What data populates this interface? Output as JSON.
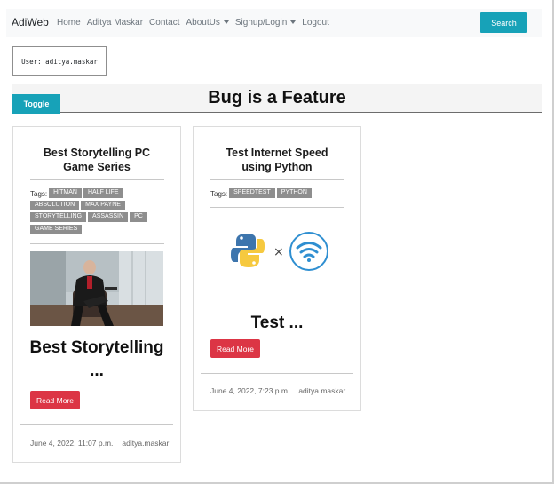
{
  "navbar": {
    "brand": "AdiWeb",
    "links": [
      "Home",
      "Aditya Maskar",
      "Contact"
    ],
    "dropdowns": [
      "AboutUs",
      "Signup/Login"
    ],
    "logout": "Logout",
    "search_label": "Search"
  },
  "user": {
    "label": "User: aditya.maskar"
  },
  "header": {
    "toggle_label": "Toggle",
    "title": "Bug is a Feature"
  },
  "cards": [
    {
      "title": "Best Storytelling PC Game Series",
      "tags_label": "Tags:",
      "tags": [
        "HITMAN",
        "HALF LIFE",
        "ABSOLUTION",
        "MAX PAYNE",
        "STORYTELLING",
        "ASSASSIN",
        "PC",
        "GAME SERIES"
      ],
      "excerpt": "Best Storytelling ...",
      "read_more": "Read More",
      "date": "June 4, 2022, 11:07 p.m.",
      "author": "aditya.maskar"
    },
    {
      "title": "Test Internet Speed using Python",
      "tags_label": "Tags:",
      "tags": [
        "SPEEDTEST",
        "PYTHON"
      ],
      "excerpt": "Test ...",
      "read_more": "Read More",
      "date": "June 4, 2022, 7:23 p.m.",
      "author": "aditya.maskar"
    }
  ],
  "colors": {
    "accent": "#17a2b8",
    "danger": "#dc3545",
    "tag": "#8e8e8e",
    "navbar_bg": "#f8f9fa"
  }
}
